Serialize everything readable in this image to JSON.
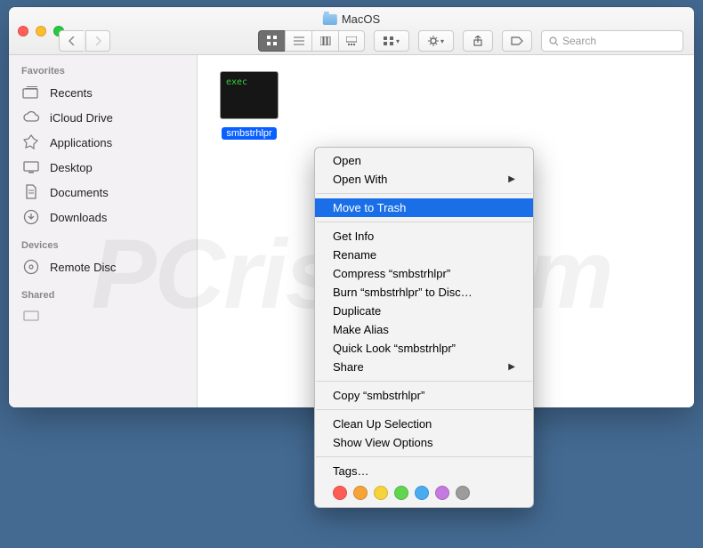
{
  "window": {
    "title": "MacOS"
  },
  "search": {
    "placeholder": "Search"
  },
  "sidebar": {
    "sections": [
      {
        "header": "Favorites",
        "items": [
          "Recents",
          "iCloud Drive",
          "Applications",
          "Desktop",
          "Documents",
          "Downloads"
        ]
      },
      {
        "header": "Devices",
        "items": [
          "Remote Disc"
        ]
      },
      {
        "header": "Shared",
        "items": []
      }
    ]
  },
  "file": {
    "name": "smbstrhlpr",
    "badge": "exec"
  },
  "menu": {
    "open": "Open",
    "open_with": "Open With",
    "move_to_trash": "Move to Trash",
    "get_info": "Get Info",
    "rename": "Rename",
    "compress": "Compress “smbstrhlpr”",
    "burn": "Burn “smbstrhlpr” to Disc…",
    "duplicate": "Duplicate",
    "make_alias": "Make Alias",
    "quick_look": "Quick Look “smbstrhlpr”",
    "share": "Share",
    "copy": "Copy “smbstrhlpr”",
    "cleanup": "Clean Up Selection",
    "view_opts": "Show View Options",
    "tags": "Tags…"
  },
  "tag_colors": [
    "#ff5c55",
    "#f6a338",
    "#f6d33a",
    "#62d550",
    "#49acf0",
    "#c57ae0",
    "#9c9c9c"
  ],
  "watermark": "PCrisk.com"
}
